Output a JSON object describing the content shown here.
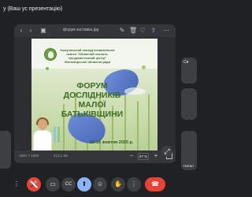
{
  "top_bar": {
    "presenter_title": "у (Ваш ус презентацію)"
  },
  "viewer": {
    "file_name": "форум заставка.jpg",
    "zoom_value": "57 %",
    "bottom_info_left": "1920 × 1080",
    "bottom_info_mid": "213,1 КБ"
  },
  "slide": {
    "org_text": "Комунальний заклад позашкільної освіти \"Обласний еколого-натуралістичний центр\" Житомирської обласної ради",
    "headline": "ФОРУМ ДОСЛІДНИКІВ МАЛОЇ БАТЬКІВЩИНИ",
    "date": "15-16 жовтня 2025 р."
  },
  "tiles": {
    "right_top_label": "Св",
    "right_mid_label": "",
    "right_bottom_label": "Натал",
    "bottom_left_label": ""
  },
  "controls": {
    "more_label": "⋮",
    "mic_label": "🎤",
    "camera_label": "▭",
    "captions_label": "CC",
    "present_label": "⬆",
    "reactions_label": "☺",
    "raise_hand_label": "✋",
    "more_options_label": "⋮",
    "end_call_label": "☎"
  },
  "colors": {
    "background": "#202124",
    "tile": "#3c4043",
    "accent_blue": "#8ab4f8",
    "danger_red": "#ea4335",
    "slide_green": "#3e6b24"
  }
}
